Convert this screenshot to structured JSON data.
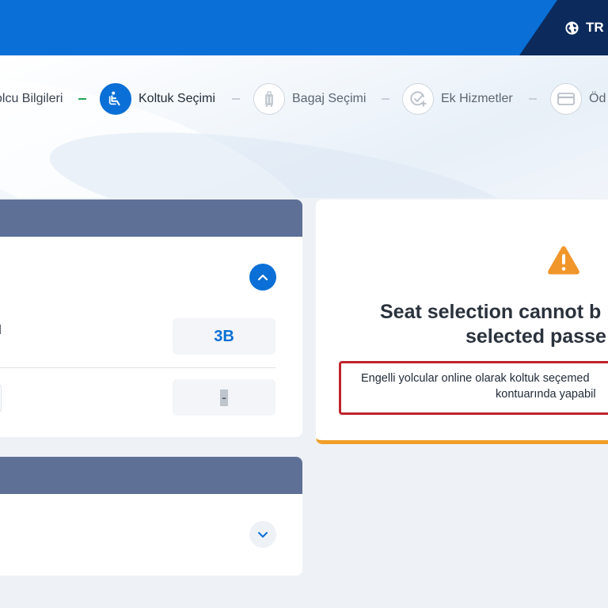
{
  "header": {
    "language_label": "TR",
    "icons": {
      "language": "globe-icon"
    },
    "colors": {
      "primary": "#0a6fd6",
      "dark": "#0c2a5c"
    }
  },
  "stepper": {
    "steps": [
      {
        "label": "olcu Bilgileri",
        "state": "done",
        "icon": ""
      },
      {
        "label": "Koltuk Seçimi",
        "state": "active",
        "icon": "seat-icon"
      },
      {
        "label": "Bagaj Seçimi",
        "state": "pending",
        "icon": "luggage-icon"
      },
      {
        "label": "Ek Hizmetler",
        "state": "pending",
        "icon": "add-service-icon"
      },
      {
        "label": "Öd",
        "state": "pending",
        "icon": "payment-card-icon"
      }
    ],
    "colors": {
      "done_separator": "#21a65a",
      "pending_separator": "#c8ced6"
    }
  },
  "seat_card": {
    "passenger_label_fragment": "u",
    "seats": [
      "3B",
      "-"
    ],
    "expanded": true
  },
  "second_card": {
    "expanded": false
  },
  "warning": {
    "icon": "warning-triangle-icon",
    "title_line1": "Seat selection cannot b",
    "title_line2": "selected passe",
    "message_line1": "Engelli yolcular online olarak koltuk seçemed",
    "message_line2": "kontuarında yapabil",
    "colors": {
      "accent": "#f0a02a",
      "border": "#c0242b"
    }
  }
}
